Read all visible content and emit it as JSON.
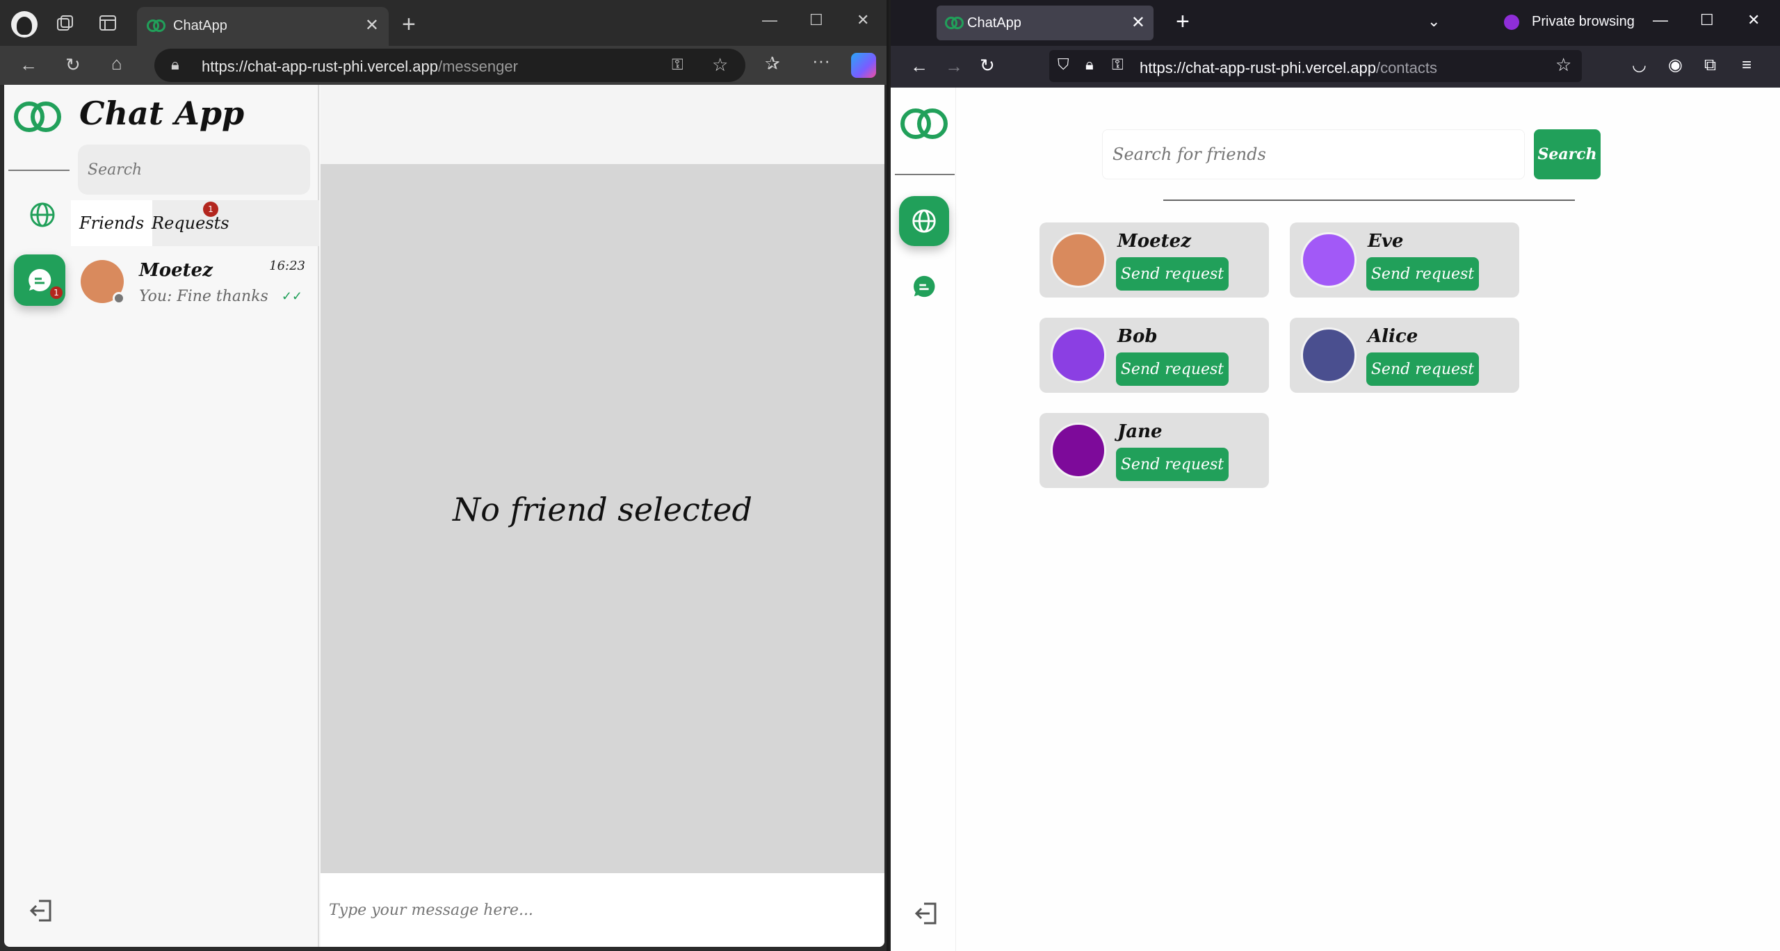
{
  "left_browser": {
    "tab_title": "ChatApp",
    "url_host": "https://chat-app-rust-phi.vercel.app",
    "url_path": "/messenger"
  },
  "messenger": {
    "app_title": "Chat App",
    "search_placeholder": "Search",
    "tabs": [
      {
        "label": "Friends"
      },
      {
        "label": "Requests"
      }
    ],
    "requests_badge": "1",
    "chat_badge": "1",
    "friends": [
      {
        "name": "Moetez",
        "time": "16:23",
        "last_message": "You: Fine thanks",
        "avatar_color": "#d98a5d"
      }
    ],
    "empty_state": "No friend selected",
    "message_placeholder": "Type your message here..."
  },
  "right_browser": {
    "tab_title": "ChatApp",
    "private_label": "Private browsing",
    "url_host": "https://chat-app-rust-phi.vercel.app",
    "url_path": "/contacts"
  },
  "contacts": {
    "search_placeholder": "Search for friends",
    "search_button": "Search",
    "people": [
      {
        "name": "Moetez",
        "button": "Send request",
        "avatar_color": "#d98a5d"
      },
      {
        "name": "Eve",
        "button": "Send request",
        "avatar_color": "#a259f7"
      },
      {
        "name": "Bob",
        "button": "Send request",
        "avatar_color": "#8b3fe3"
      },
      {
        "name": "Alice",
        "button": "Send request",
        "avatar_color": "#4a4f8f"
      },
      {
        "name": "Jane",
        "button": "Send request",
        "avatar_color": "#7d0a9a"
      }
    ]
  },
  "colors": {
    "accent": "#21a05a",
    "badge": "#b3261e"
  }
}
